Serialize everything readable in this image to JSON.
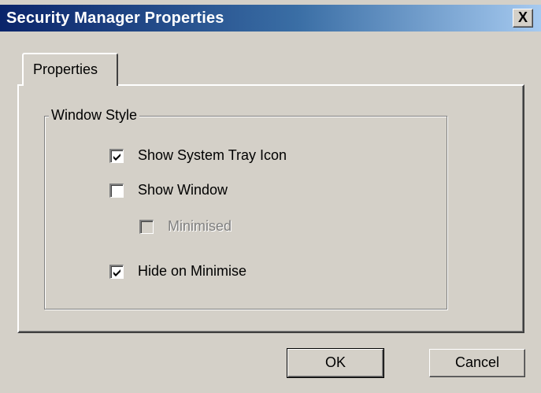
{
  "window": {
    "title": "Security Manager Properties",
    "close_glyph": "X"
  },
  "tabs": [
    {
      "label": "Properties",
      "selected": true
    }
  ],
  "group": {
    "label": "Window Style",
    "options": [
      {
        "label": "Show System Tray Icon",
        "checked": true,
        "enabled": true
      },
      {
        "label": "Show Window",
        "checked": false,
        "enabled": true
      },
      {
        "label": "Minimised",
        "checked": false,
        "enabled": false
      },
      {
        "label": "Hide on Minimise",
        "checked": true,
        "enabled": true
      }
    ]
  },
  "buttons": {
    "ok": "OK",
    "cancel": "Cancel"
  },
  "icons": {
    "close": "close-icon",
    "check": "checkmark-icon"
  },
  "colors": {
    "titlebar_start": "#0a246a",
    "titlebar_end": "#a6caf0",
    "face": "#d4d0c8"
  }
}
